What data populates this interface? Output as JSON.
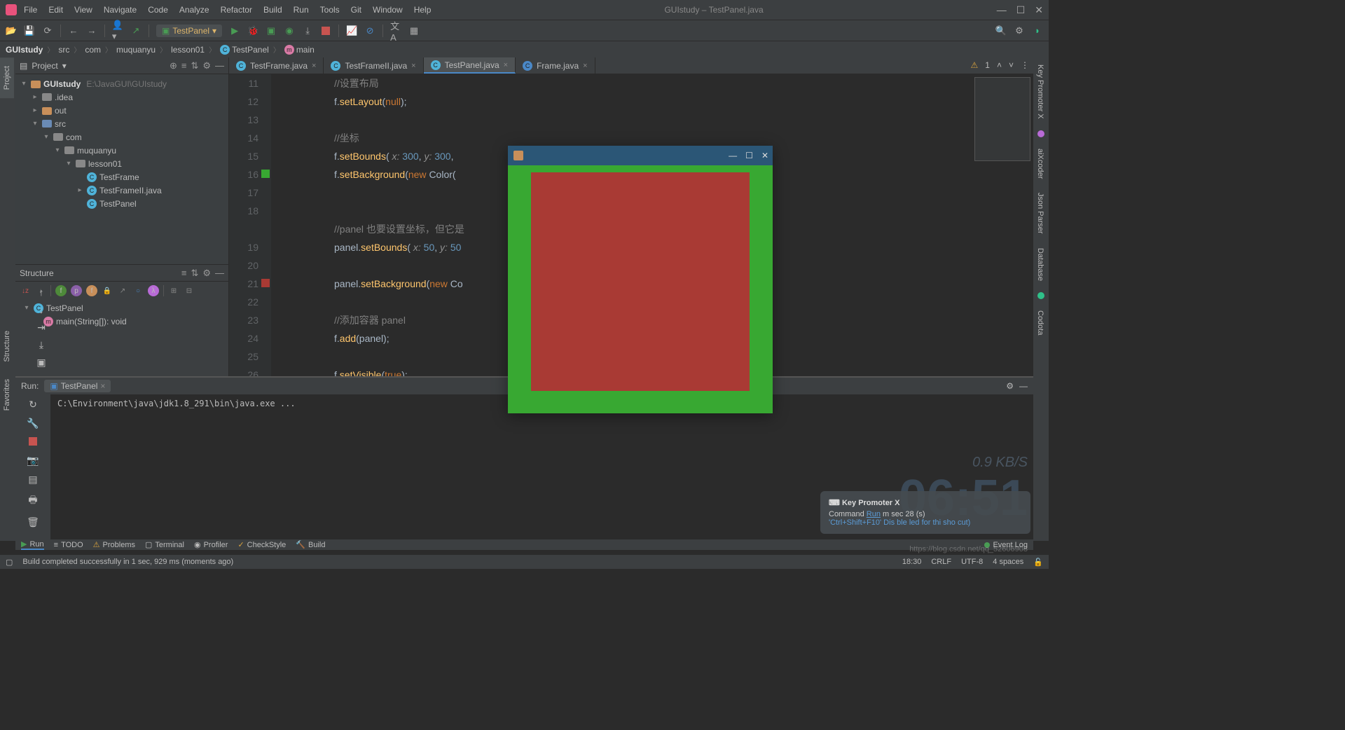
{
  "menubar": [
    "File",
    "Edit",
    "View",
    "Navigate",
    "Code",
    "Analyze",
    "Refactor",
    "Build",
    "Run",
    "Tools",
    "Git",
    "Window",
    "Help"
  ],
  "window_title": "GUIstudy – TestPanel.java",
  "run_config": "TestPanel",
  "breadcrumb": {
    "project": "GUIstudy",
    "parts": [
      "src",
      "com",
      "muquanyu",
      "lesson01"
    ],
    "class": "TestPanel",
    "method": "main"
  },
  "project_panel": {
    "title": "Project",
    "root": "GUIstudy",
    "root_path": "E:\\JavaGUI\\GUIstudy",
    "nodes": [
      {
        "indent": 1,
        "arrow": ">",
        "icon": "folder-grey",
        "label": ".idea"
      },
      {
        "indent": 1,
        "arrow": ">",
        "icon": "folder-ico",
        "label": "out"
      },
      {
        "indent": 1,
        "arrow": "v",
        "icon": "folder-blue",
        "label": "src"
      },
      {
        "indent": 2,
        "arrow": "v",
        "icon": "pkg-ico",
        "label": "com"
      },
      {
        "indent": 3,
        "arrow": "v",
        "icon": "pkg-ico",
        "label": "muquanyu"
      },
      {
        "indent": 4,
        "arrow": "v",
        "icon": "pkg-ico",
        "label": "lesson01"
      },
      {
        "indent": 5,
        "arrow": "",
        "icon": "class-ico",
        "label": "TestFrame"
      },
      {
        "indent": 5,
        "arrow": ">",
        "icon": "class-ico",
        "label": "TestFrameII.java"
      },
      {
        "indent": 5,
        "arrow": "",
        "icon": "class-ico",
        "label": "TestPanel"
      }
    ]
  },
  "structure_panel": {
    "title": "Structure",
    "class": "TestPanel",
    "method": "main(String[]): void"
  },
  "editor": {
    "tabs": [
      {
        "label": "TestFrame.java",
        "active": false
      },
      {
        "label": "TestFrameII.java",
        "active": false
      },
      {
        "label": "TestPanel.java",
        "active": true
      },
      {
        "label": "Frame.java",
        "active": false
      }
    ],
    "warnings": "1",
    "lines": [
      {
        "n": 11,
        "cm": "//设置布局"
      },
      {
        "n": 12,
        "code": "f.setLayout(null);"
      },
      {
        "n": 13,
        "code": ""
      },
      {
        "n": 14,
        "cm": "//坐标"
      },
      {
        "n": 15,
        "code": "f.setBounds( x: 300, y: 300,"
      },
      {
        "n": 16,
        "code": "f.setBackground(new Color(",
        "mark": "green"
      },
      {
        "n": 17,
        "code": ""
      },
      {
        "n": 18,
        "code": ""
      },
      {
        "n": "",
        "cm": "//panel 也要设置坐标，但它是"
      },
      {
        "n": 19,
        "code": "panel.setBounds( x: 50, y: 50"
      },
      {
        "n": 20,
        "code": ""
      },
      {
        "n": 21,
        "code": "panel.setBackground(new Co",
        "mark": "red"
      },
      {
        "n": 22,
        "code": ""
      },
      {
        "n": 23,
        "cm": "//添加容器 panel"
      },
      {
        "n": 24,
        "code": "f.add(panel);"
      },
      {
        "n": 25,
        "code": ""
      },
      {
        "n": 26,
        "code": "f.setVisible(true);"
      }
    ]
  },
  "run_panel": {
    "title": "Run:",
    "tab": "TestPanel",
    "output": "C:\\Environment\\java\\jdk1.8_291\\bin\\java.exe ..."
  },
  "bottom_tabs": [
    "Run",
    "TODO",
    "Problems",
    "Terminal",
    "Profiler",
    "CheckStyle",
    "Build"
  ],
  "event_log": "Event Log",
  "status": {
    "msg": "Build completed successfully in 1 sec, 929 ms (moments ago)",
    "time": "18:30",
    "eol": "CRLF",
    "encoding": "UTF-8",
    "indent": "4 spaces"
  },
  "left_tabs": [
    "Project",
    "Structure",
    "Favorites"
  ],
  "right_tabs": [
    "Key Promoter X",
    "aiXcoder",
    "Json Parser",
    "Database",
    "Codota"
  ],
  "notif": {
    "title": "Key Promoter X",
    "line1_a": "Command ",
    "line1_b": "Run",
    "line1_c": " m sec 28     (s)",
    "line2": "'Ctrl+Shift+F10'   Dis ble  led for thi sho cut)"
  },
  "bg": {
    "speed": "0.9 KB/S",
    "clock": "06:51"
  },
  "watermark": "https://blog.csdn.net/qq_52606908"
}
